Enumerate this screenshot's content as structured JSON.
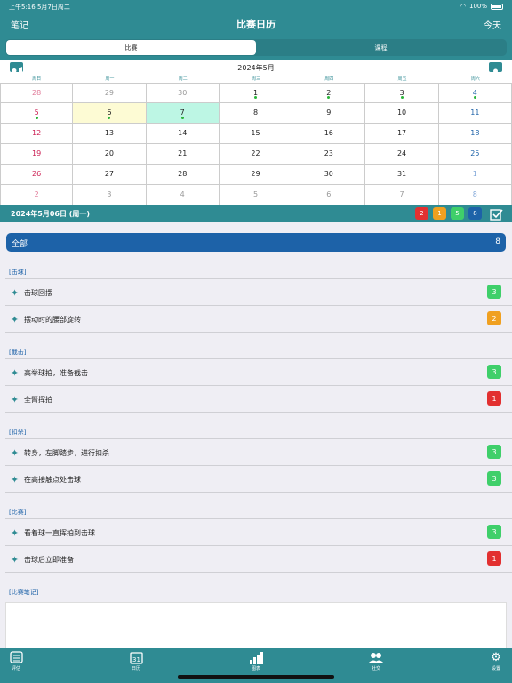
{
  "status": {
    "time": "上午5:16 5月7日周二",
    "battery": "100%"
  },
  "nav": {
    "left": "笔记",
    "title": "比赛日历",
    "right": "今天"
  },
  "segments": [
    {
      "label": "比赛",
      "active": true
    },
    {
      "label": "课程",
      "active": false
    }
  ],
  "month_title": "2024年5月",
  "weekdays": [
    "周日",
    "周一",
    "周二",
    "周三",
    "周四",
    "周五",
    "周六"
  ],
  "weeks": [
    [
      "28",
      "29",
      "30",
      "1",
      "2",
      "3",
      "4"
    ],
    [
      "5",
      "6",
      "7",
      "8",
      "9",
      "10",
      "11"
    ],
    [
      "12",
      "13",
      "14",
      "15",
      "16",
      "17",
      "18"
    ],
    [
      "19",
      "20",
      "21",
      "22",
      "23",
      "24",
      "25"
    ],
    [
      "26",
      "27",
      "28",
      "29",
      "30",
      "31",
      "1"
    ],
    [
      "2",
      "3",
      "4",
      "5",
      "6",
      "7",
      "8"
    ]
  ],
  "dots": [
    [
      0,
      3
    ],
    [
      0,
      4
    ],
    [
      0,
      5
    ],
    [
      0,
      6
    ],
    [
      1,
      0
    ],
    [
      1,
      1
    ],
    [
      1,
      2
    ]
  ],
  "day_colors": {
    "sunday": "#cc2255",
    "saturday": "#1d62a8",
    "weekday": "#222222",
    "other_month_weekday": "#999999",
    "other_month_sunday": "#e07a98",
    "other_month_saturday": "#7fa6d8"
  },
  "highlight_colors": {
    "yellow": "#fdfbd4",
    "mint": "#bdf6e4"
  },
  "date_label": "2024年5月06日 (周一)",
  "counts": [
    {
      "value": "2",
      "color": "#e23030"
    },
    {
      "value": "1",
      "color": "#f0a020"
    },
    {
      "value": "5",
      "color": "#3fcf6a"
    },
    {
      "value": "8",
      "color": "#1d62a8"
    }
  ],
  "all": {
    "label": "全部",
    "count": "8"
  },
  "sections": [
    {
      "title": "[击球]",
      "items": [
        {
          "text": "击球回摆",
          "badge": "3",
          "color": "#3fcf6a",
          "icon": "swing-icon"
        },
        {
          "text": "摆动时的腰部旋转",
          "badge": "2",
          "color": "#f0a020",
          "icon": "swing-icon"
        }
      ]
    },
    {
      "title": "[截击]",
      "items": [
        {
          "text": "高举球拍，准备截击",
          "badge": "3",
          "color": "#3fcf6a",
          "icon": "volley-icon"
        },
        {
          "text": "全臂挥拍",
          "badge": "1",
          "color": "#e23030",
          "icon": "volley-icon"
        }
      ]
    },
    {
      "title": "[扣杀]",
      "items": [
        {
          "text": "转身，左脚踏步，进行扣杀",
          "badge": "3",
          "color": "#3fcf6a",
          "icon": "smash-icon"
        },
        {
          "text": "在高接触点处击球",
          "badge": "3",
          "color": "#3fcf6a",
          "icon": "smash-icon"
        }
      ]
    },
    {
      "title": "[比赛]",
      "items": [
        {
          "text": "看着球一直挥拍到击球",
          "badge": "3",
          "color": "#3fcf6a",
          "icon": "match-icon"
        },
        {
          "text": "击球后立即准备",
          "badge": "1",
          "color": "#e23030",
          "icon": "match-icon"
        }
      ]
    }
  ],
  "notes_title": "[比赛笔记]",
  "tabs": [
    {
      "label": "评估",
      "icon": "list-icon"
    },
    {
      "label": "日历",
      "icon": "calendar-icon"
    },
    {
      "label": "图表",
      "icon": "chart-icon"
    },
    {
      "label": "社交",
      "icon": "people-icon"
    },
    {
      "label": "设置",
      "icon": "gear-icon"
    }
  ]
}
